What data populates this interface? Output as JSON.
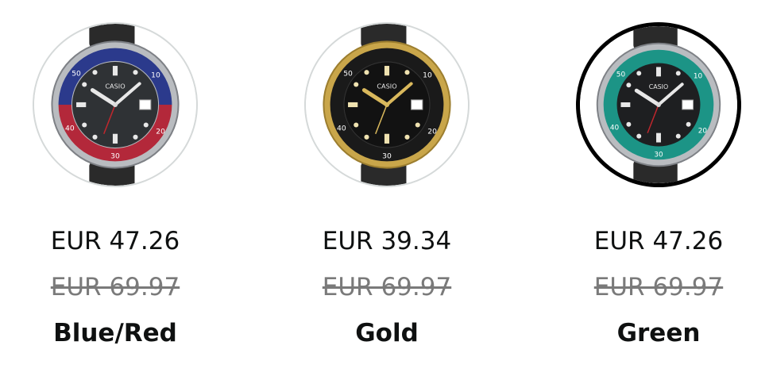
{
  "swatches": [
    {
      "name": "Blue/Red",
      "price": "EUR 47.26",
      "list_price": "EUR 69.97",
      "selected": false,
      "bezel_top_color": "#2b3a8c",
      "bezel_bottom_color": "#b3283a",
      "brand": "CASIO",
      "bezel_numbers": [
        "50",
        "40",
        "30",
        "10",
        "20"
      ]
    },
    {
      "name": "Gold",
      "price": "EUR 39.34",
      "list_price": "EUR 69.97",
      "selected": false,
      "bezel_top_color": "#1a1a1a",
      "bezel_bottom_color": "#1a1a1a",
      "brand": "CASIO",
      "bezel_numbers": [
        "50",
        "40",
        "30",
        "10",
        "20"
      ]
    },
    {
      "name": "Green",
      "price": "EUR 47.26",
      "list_price": "EUR 69.97",
      "selected": true,
      "bezel_top_color": "#1c9486",
      "bezel_bottom_color": "#1c9486",
      "brand": "CASIO",
      "bezel_numbers": [
        "50",
        "40",
        "30",
        "10",
        "20"
      ]
    }
  ],
  "colors": {
    "selected_border": "#000000",
    "unselected_border": "#d5d9d9",
    "strike_text": "#7a7a7a"
  }
}
